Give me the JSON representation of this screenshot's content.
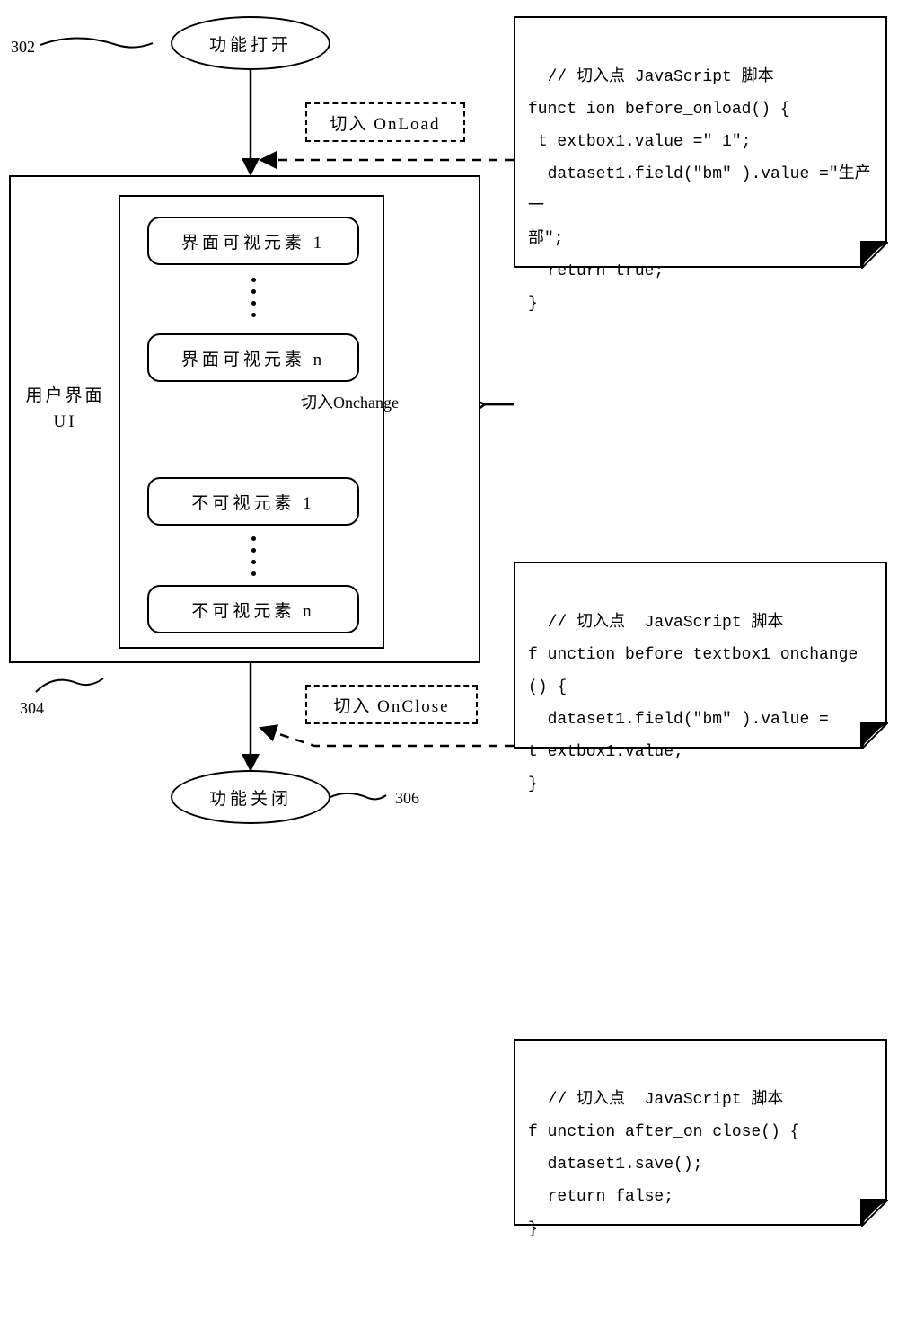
{
  "labels": {
    "ref302": "302",
    "ref304": "304",
    "ref306": "306",
    "start": "功能打开",
    "end": "功能关闭",
    "cutOnLoad": "切入 OnLoad",
    "cutOnClose": "切入 OnClose",
    "cutOnChange": "切入Onchange",
    "uiLabel": "用户界面\nUI",
    "visEl1": "界面可视元素 1",
    "visEln": "界面可视元素 n",
    "invisEl1": "不可视元素 1",
    "invisEln": "不可视元素 n"
  },
  "scripts": {
    "onload": "// 切入点 JavaScript 脚本\nfunct ion before_onload() {\n t extbox1.value =\" 1\";\n  dataset1.field(\"bm\" ).value =\"生产一\n部\";\n  return true;\n}",
    "onchange": "// 切入点  JavaScript 脚本\nf unction before_textbox1_onchange() {\n  dataset1.field(\"bm\" ).value =\nt extbox1.value;\n}",
    "onclose": "// 切入点  JavaScript 脚本\nf unction after_on close() {\n  dataset1.save();\n  return false;\n}"
  },
  "chart_data": {
    "type": "flow-diagram",
    "nodes": [
      {
        "id": "302",
        "type": "terminator",
        "label": "功能打开"
      },
      {
        "id": "304",
        "type": "process",
        "label": "用户界面 UI",
        "children": [
          {
            "id": "v1",
            "label": "界面可视元素 1"
          },
          {
            "id": "vn",
            "label": "界面可视元素 n"
          },
          {
            "id": "iv1",
            "label": "不可视元素 1"
          },
          {
            "id": "ivn",
            "label": "不可视元素 n"
          }
        ]
      },
      {
        "id": "306",
        "type": "terminator",
        "label": "功能关闭"
      },
      {
        "id": "hook_onload",
        "type": "hook",
        "label": "切入 OnLoad"
      },
      {
        "id": "hook_onclose",
        "type": "hook",
        "label": "切入 OnClose"
      },
      {
        "id": "script_onload",
        "type": "script",
        "code": "function before_onload(){ textbox1.value=\"1\"; dataset1.field(\"bm\").value=\"生产一部\"; return true; }"
      },
      {
        "id": "script_onchange",
        "type": "script",
        "code": "function before_textbox1_onchange(){ dataset1.field(\"bm\").value = textbox1.value; }"
      },
      {
        "id": "script_onclose",
        "type": "script",
        "code": "function after_onclose(){ dataset1.save(); return false; }"
      }
    ],
    "edges": [
      {
        "from": "302",
        "to": "304",
        "style": "solid"
      },
      {
        "from": "304",
        "to": "306",
        "style": "solid"
      },
      {
        "from": "script_onload",
        "to": "hook_onload",
        "style": "dashed",
        "label": "切入 OnLoad"
      },
      {
        "from": "script_onclose",
        "to": "hook_onclose",
        "style": "dashed",
        "label": "切入 OnClose"
      },
      {
        "from": "script_onchange",
        "to": "vn",
        "style": "solid",
        "label": "切入Onchange"
      },
      {
        "from": "script_onchange",
        "to": "iv1",
        "style": "solid",
        "label": "切入Onchange"
      }
    ]
  }
}
